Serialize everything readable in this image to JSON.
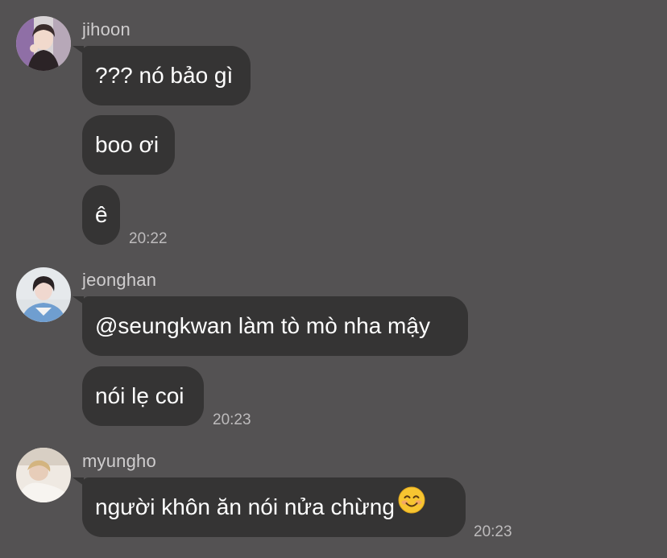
{
  "messages": {
    "group1": {
      "sender": "jihoon",
      "bubbles": [
        "??? nó bảo gì",
        "boo ơi",
        "ê"
      ],
      "time": "20:22"
    },
    "group2": {
      "sender": "jeonghan",
      "bubbles": [
        "@seungkwan làm tò mò nha mậy",
        "nói lẹ coi"
      ],
      "time": "20:23"
    },
    "group3": {
      "sender": "myungho",
      "bubbles": [
        "người khôn ăn nói nửa chừng"
      ],
      "emoji": "smiling-face-emoji",
      "time": "20:23"
    }
  },
  "colors": {
    "background": "#545253",
    "bubble": "#353434",
    "text": "#ffffff",
    "sender_name": "#cfcdce",
    "timestamp": "#bdbbbc"
  }
}
